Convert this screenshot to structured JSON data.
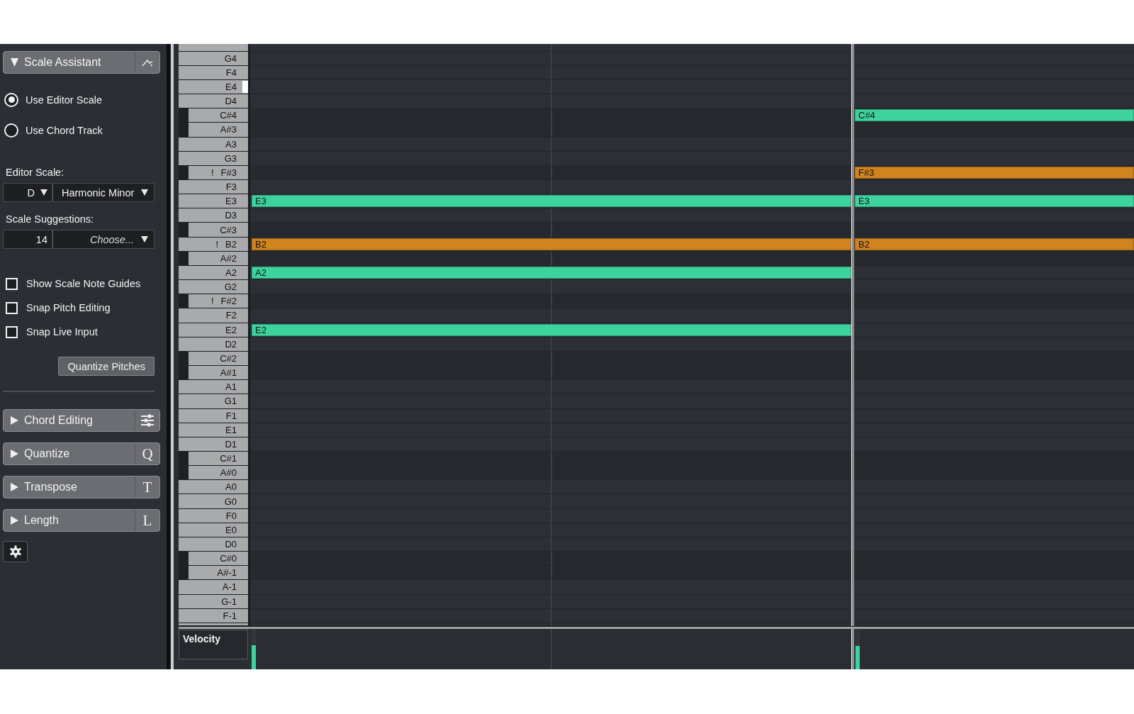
{
  "sections": [
    {
      "label": "Scale Assistant",
      "expanded": true
    },
    {
      "label": "Chord Editing",
      "expanded": false
    },
    {
      "label": "Quantize",
      "expanded": false,
      "letter": "Q"
    },
    {
      "label": "Transpose",
      "expanded": false,
      "letter": "T"
    },
    {
      "label": "Length",
      "expanded": false,
      "letter": "L"
    }
  ],
  "scale_assistant": {
    "scale_source": [
      {
        "label": "Use Editor Scale",
        "selected": true
      },
      {
        "label": "Use Chord Track",
        "selected": false
      }
    ],
    "editor_scale": {
      "label": "Editor Scale:",
      "root": "D",
      "scale": "Harmonic Minor"
    },
    "scale_suggestions": {
      "label": "Scale Suggestions:",
      "count": "14",
      "choice": "Choose..."
    },
    "options": [
      {
        "label": "Show Scale Note Guides",
        "checked": false
      },
      {
        "label": "Snap Pitch Editing",
        "checked": false
      },
      {
        "label": "Snap Live Input",
        "checked": false
      }
    ],
    "quantize_button": "Quantize Pitches"
  },
  "piano_roll": {
    "keys": [
      {
        "label": "G4",
        "kind": "white",
        "highlighted": false
      },
      {
        "label": "F4",
        "kind": "white",
        "highlighted": false
      },
      {
        "label": "E4",
        "kind": "white",
        "highlighted": true
      },
      {
        "label": "D4",
        "kind": "white",
        "highlighted": false
      },
      {
        "label": "C#4",
        "kind": "black",
        "highlighted": false,
        "second_note": {
          "label": "C#4",
          "color": "#3dd39e"
        }
      },
      {
        "label": "A#3",
        "kind": "black",
        "highlighted": false
      },
      {
        "label": "A3",
        "kind": "white",
        "highlighted": false
      },
      {
        "label": "G3",
        "kind": "white",
        "highlighted": false
      },
      {
        "label": "F#3",
        "flag": "!",
        "kind": "black",
        "highlighted": false,
        "second_note": {
          "label": "F#3",
          "color": "#cf841e"
        }
      },
      {
        "label": "F3",
        "kind": "white",
        "highlighted": false
      },
      {
        "label": "E3",
        "kind": "white",
        "highlighted": false,
        "first_note": {
          "label": "E3",
          "color": "#3dd39e"
        },
        "second_note": {
          "label": "E3",
          "color": "#3dd39e"
        }
      },
      {
        "label": "D3",
        "kind": "white",
        "highlighted": false
      },
      {
        "label": "C#3",
        "kind": "black",
        "highlighted": false
      },
      {
        "label": "B2",
        "flag": "!",
        "kind": "white",
        "highlighted": false,
        "first_note": {
          "label": "B2",
          "color": "#cf841e"
        },
        "second_note": {
          "label": "B2",
          "color": "#cf841e"
        }
      },
      {
        "label": "A#2",
        "kind": "black",
        "highlighted": false
      },
      {
        "label": "A2",
        "kind": "white",
        "highlighted": false,
        "first_note": {
          "label": "A2",
          "color": "#3dd39e"
        }
      },
      {
        "label": "G2",
        "kind": "white",
        "highlighted": false
      },
      {
        "label": "F#2",
        "flag": "!",
        "kind": "black",
        "highlighted": false
      },
      {
        "label": "F2",
        "kind": "white",
        "highlighted": false
      },
      {
        "label": "E2",
        "kind": "white",
        "highlighted": false,
        "first_note": {
          "label": "E2",
          "color": "#3dd39e"
        }
      },
      {
        "label": "D2",
        "kind": "white",
        "highlighted": false
      },
      {
        "label": "C#2",
        "kind": "black",
        "highlighted": false
      },
      {
        "label": "A#1",
        "kind": "black",
        "highlighted": false
      },
      {
        "label": "A1",
        "kind": "white",
        "highlighted": false
      },
      {
        "label": "G1",
        "kind": "white",
        "highlighted": false
      },
      {
        "label": "F1",
        "kind": "white",
        "highlighted": false
      },
      {
        "label": "E1",
        "kind": "white",
        "highlighted": false
      },
      {
        "label": "D1",
        "kind": "white",
        "highlighted": false
      },
      {
        "label": "C#1",
        "kind": "black",
        "highlighted": false
      },
      {
        "label": "A#0",
        "kind": "black",
        "highlighted": false
      },
      {
        "label": "A0",
        "kind": "white",
        "highlighted": false
      },
      {
        "label": "G0",
        "kind": "white",
        "highlighted": false
      },
      {
        "label": "F0",
        "kind": "white",
        "highlighted": false
      },
      {
        "label": "E0",
        "kind": "white",
        "highlighted": false
      },
      {
        "label": "D0",
        "kind": "white",
        "highlighted": false
      },
      {
        "label": "C#0",
        "kind": "black",
        "highlighted": false
      },
      {
        "label": "A#-1",
        "kind": "black",
        "highlighted": false
      },
      {
        "label": "A-1",
        "kind": "white",
        "highlighted": false
      },
      {
        "label": "G-1",
        "kind": "white",
        "highlighted": false
      },
      {
        "label": "F-1",
        "kind": "white",
        "highlighted": false
      }
    ],
    "velocity": {
      "label": "Velocity",
      "first_bar": {
        "color": "#3dd39e",
        "level": 0.6
      },
      "second_bar": {
        "color": "#3dd39e",
        "level": 0.58
      }
    }
  }
}
